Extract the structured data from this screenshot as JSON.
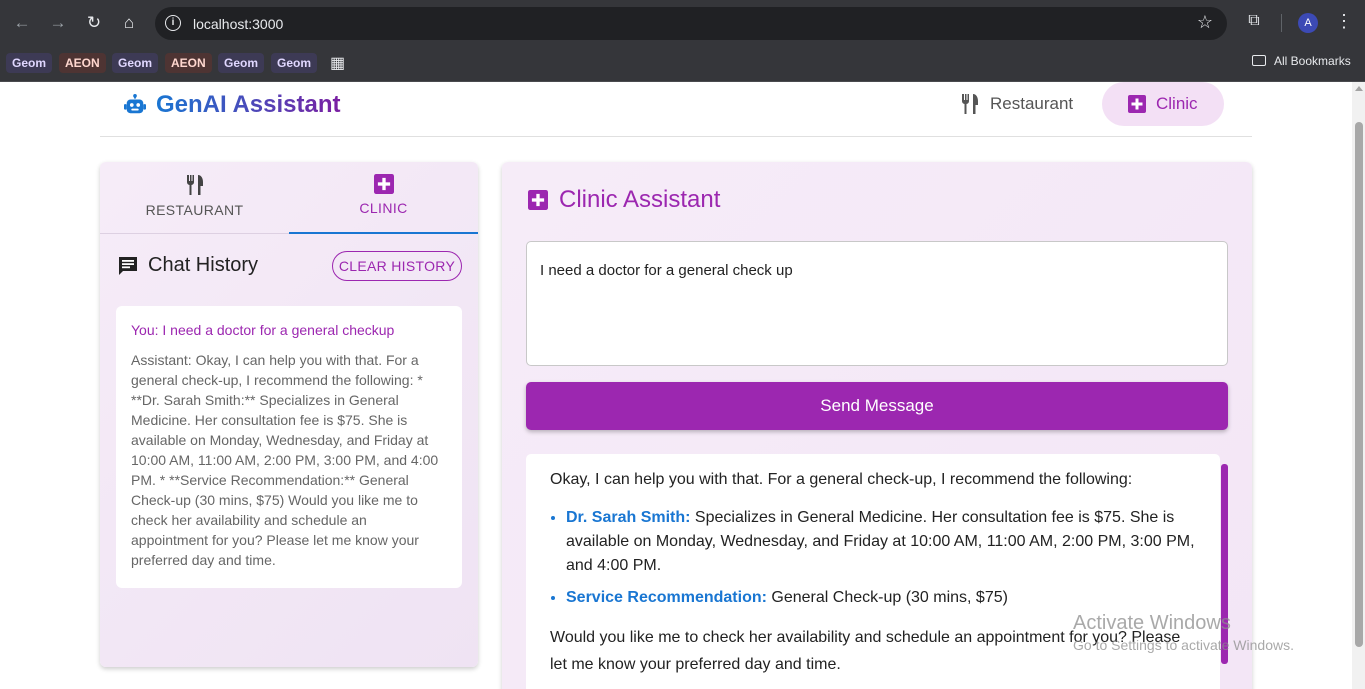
{
  "browser": {
    "url": "localhost:3000",
    "profile_initial": "A",
    "bookmarks": [
      "Geom",
      "AEON",
      "Geom",
      "AEON",
      "Geom",
      "Geom"
    ],
    "all_bookmarks": "All Bookmarks"
  },
  "header": {
    "title": "GenAI Assistant",
    "tabs": [
      {
        "label": "Restaurant",
        "icon": "fork-knife-icon"
      },
      {
        "label": "Clinic",
        "icon": "medical-plus-icon"
      }
    ]
  },
  "sidebar": {
    "tabs": [
      {
        "label": "RESTAURANT",
        "icon": "fork-knife-icon"
      },
      {
        "label": "CLINIC",
        "icon": "medical-plus-icon"
      }
    ],
    "history_title": "Chat History",
    "clear_label": "CLEAR HISTORY",
    "history": [
      {
        "user": "You: I need a doctor for a general checkup",
        "assistant": "Assistant: Okay, I can help you with that. For a general check-up, I recommend the following: * **Dr. Sarah Smith:** Specializes in General Medicine. Her consultation fee is $75. She is available on Monday, Wednesday, and Friday at 10:00 AM, 11:00 AM, 2:00 PM, 3:00 PM, and 4:00 PM. * **Service Recommendation:** General Check-up (30 mins, $75) Would you like me to check her availability and schedule an appointment for you? Please let me know your preferred day and time."
      }
    ]
  },
  "main": {
    "title": "Clinic Assistant",
    "input_value": "I need a doctor for a general check up",
    "send_label": "Send Message",
    "response": {
      "intro": "Okay, I can help you with that. For a general check-up, I recommend the following:",
      "items": [
        {
          "label": "Dr. Sarah Smith:",
          "text": " Specializes in General Medicine. Her consultation fee is $75. She is available on Monday, Wednesday, and Friday at 10:00 AM, 11:00 AM, 2:00 PM, 3:00 PM, and 4:00 PM."
        },
        {
          "label": "Service Recommendation:",
          "text": " General Check-up (30 mins, $75)"
        }
      ],
      "outro": "Would you like me to check her availability and schedule an appointment for you? Please let me know your preferred day and time."
    }
  },
  "watermark": {
    "line1": "Activate Windows",
    "line2": "Go to Settings to activate Windows."
  },
  "colors": {
    "accent": "#9c27b0",
    "primary": "#1976d2"
  }
}
